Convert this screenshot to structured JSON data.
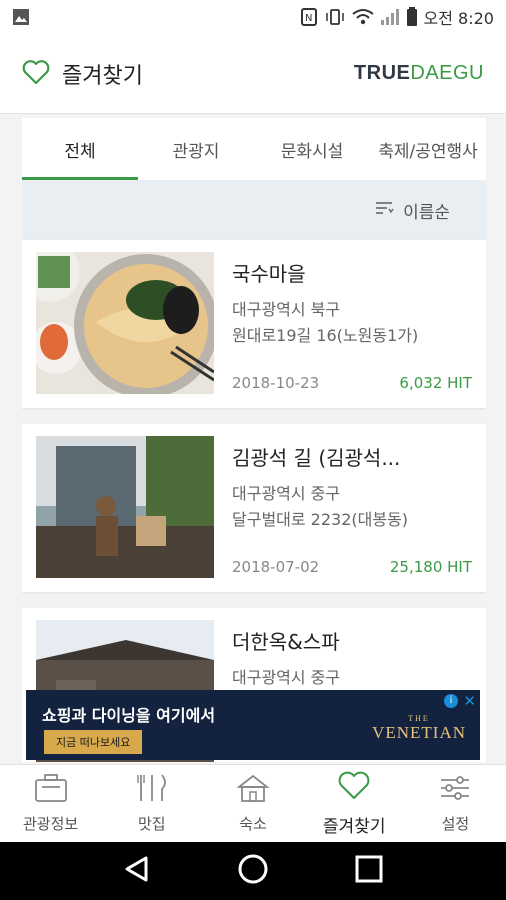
{
  "status_bar": {
    "time": "오전 8:20",
    "icons": [
      "image-icon",
      "nfc-icon",
      "vibrate-icon",
      "wifi-icon",
      "signal-icon",
      "battery-icon"
    ]
  },
  "header": {
    "title": "즐겨찾기",
    "brand_primary": "TRUE",
    "brand_secondary": "DAEGU",
    "icon": "heart-outline-icon"
  },
  "tabs": [
    {
      "label": "전체",
      "active": true
    },
    {
      "label": "관광지",
      "active": false
    },
    {
      "label": "문화시설",
      "active": false
    },
    {
      "label": "축제/공연행사",
      "active": false
    }
  ],
  "sort": {
    "label": "이름순",
    "icon": "sort-icon"
  },
  "items": [
    {
      "name": "국수마을",
      "address_line1": "대구광역시 북구",
      "address_line2": "원대로19길 16(노원동1가)",
      "date": "2018-10-23",
      "hits": "6,032 HIT"
    },
    {
      "name": "김광석 길 (김광석...",
      "address_line1": "대구광역시 중구",
      "address_line2": "달구벌대로 2232(대봉동)",
      "date": "2018-07-02",
      "hits": "25,180 HIT"
    },
    {
      "name": "더한옥&스파",
      "address_line1": "대구광역시 중구",
      "address_line2": "",
      "date": "",
      "hits": ""
    }
  ],
  "ad": {
    "headline": "쇼핑과 다이닝을 여기에서",
    "cta": "지금 떠나보세요",
    "logo_text": "VENETIAN",
    "logo_sub": "THE"
  },
  "bottom_nav": [
    {
      "label": "관광정보",
      "icon": "briefcase-icon",
      "active": false
    },
    {
      "label": "맛집",
      "icon": "fork-knife-icon",
      "active": false
    },
    {
      "label": "숙소",
      "icon": "house-icon",
      "active": false
    },
    {
      "label": "즐겨찾기",
      "icon": "heart-icon",
      "active": true
    },
    {
      "label": "설정",
      "icon": "sliders-icon",
      "active": false
    }
  ],
  "colors": {
    "accent": "#3a9a46",
    "brand_dark": "#2f3a45",
    "sort_bg": "#e8eef2",
    "ad_bg": "#13233f"
  }
}
